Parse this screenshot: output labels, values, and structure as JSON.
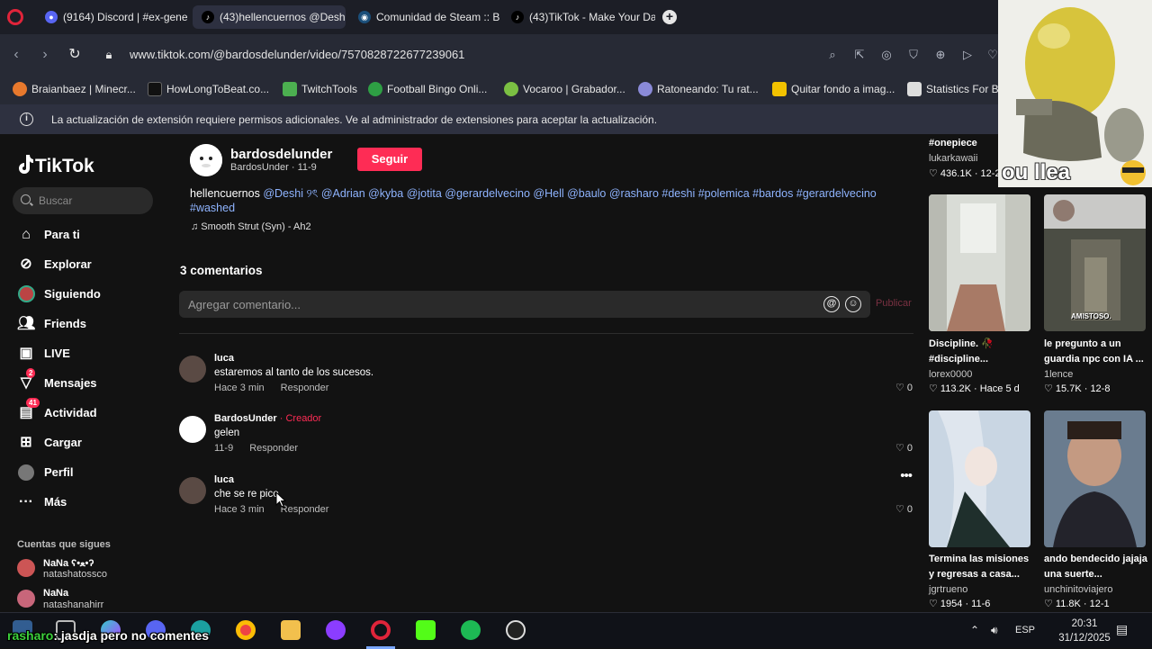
{
  "browser": {
    "tabs": [
      {
        "label": "(9164) Discord | #ex-gene",
        "icon": "discord-icon",
        "active": false
      },
      {
        "label": "(43)hellencuernos @Desh",
        "icon": "tiktok-icon",
        "active": true
      },
      {
        "label": "Comunidad de Steam :: Br",
        "icon": "steam-icon",
        "active": false
      },
      {
        "label": "(43)TikTok - Make Your Da",
        "icon": "tiktok-icon",
        "active": false
      }
    ],
    "new_tab": "+",
    "url": "www.tiktok.com/@bardosdelunder/video/7570828722677239061",
    "bookmarks": [
      {
        "label": "Braianbaez | Minecr...",
        "color": "#e8792d"
      },
      {
        "label": "HowLongToBeat.co...",
        "color": "#111111"
      },
      {
        "label": "TwitchTools",
        "color": "#4caf50"
      },
      {
        "label": "Football Bingo Onli...",
        "color": "#2e9f44"
      },
      {
        "label": "Vocaroo | Grabador...",
        "color": "#7bc043"
      },
      {
        "label": "Ratoneando: Tu rat...",
        "color": "#8a8ad8"
      },
      {
        "label": "Quitar fondo a imag...",
        "color": "#f2c200"
      },
      {
        "label": "Statistics For Be",
        "color": "#dddddd"
      }
    ],
    "info_message": "La actualización de extensión requiere permisos adicionales. Ve al administrador de extensiones para aceptar la actualización."
  },
  "webcam": {
    "caption": "ou llea"
  },
  "sidebar": {
    "logo": "TikTok",
    "search_placeholder": "Buscar",
    "nav": [
      {
        "label": "Para ti",
        "icon": "home-icon"
      },
      {
        "label": "Explorar",
        "icon": "compass-icon"
      },
      {
        "label": "Siguiendo",
        "icon": "following-avatar-icon"
      },
      {
        "label": "Friends",
        "icon": "friends-icon"
      },
      {
        "label": "LIVE",
        "icon": "live-icon"
      },
      {
        "label": "Mensajes",
        "icon": "messages-icon",
        "badge": "2"
      },
      {
        "label": "Actividad",
        "icon": "activity-icon",
        "badge": "41"
      },
      {
        "label": "Cargar",
        "icon": "upload-icon"
      },
      {
        "label": "Perfil",
        "icon": "profile-avatar-icon"
      },
      {
        "label": "Más",
        "icon": "more-icon"
      }
    ],
    "following_header": "Cuentas que sigues",
    "following": [
      {
        "name": "NaNa ʕ•ﻌ•ʔ",
        "handle": "natashatossco"
      },
      {
        "name": "NaNa",
        "handle": "natashanahirr"
      }
    ]
  },
  "video": {
    "author_name": "bardosdelunder",
    "author_sub": "BardosUnder · 11-9",
    "follow_label": "Seguir",
    "description_text": "hellencuernos",
    "description_tags": "@Deshi ୨ৎ @Adrian @kyba @jotita @gerardelvecino @Hell @baulo @rasharo #deshi #polemica #bardos #gerardelvecino #washed",
    "music": "♫ Smooth Strut (Syn) - Ah2"
  },
  "comments_section": {
    "title": "3 comentarios",
    "placeholder": "Agregar comentario...",
    "publish": "Publicar",
    "reply_label": "Responder",
    "comments": [
      {
        "user": "luca",
        "creator": "",
        "text": "estaremos al tanto de los sucesos.",
        "time": "Hace 3 min",
        "likes": "0"
      },
      {
        "user": "BardosUnder",
        "creator": " · Creador",
        "text": "gelen",
        "time": "11-9",
        "likes": "0"
      },
      {
        "user": "luca",
        "creator": "",
        "text": "che se re pico",
        "time": "Hace 3 min",
        "likes": "0"
      }
    ]
  },
  "related": {
    "top": [
      {
        "title": "#onepiece",
        "user": "lukarkawaii",
        "stats": "♡ 436.1K · 12-2"
      }
    ],
    "videos": [
      {
        "title": "Discipline. 🥀 #discipline...",
        "user": "lorex0000",
        "stats": "♡ 113.2K · Hace 5 d"
      },
      {
        "title": "le pregunto a un guardia npc con IA ...",
        "user": "1lence",
        "stats": "♡ 15.7K · 12-8",
        "thumb_text": "AMISTOSO."
      },
      {
        "title": "Termina las misiones y regresas a casa...",
        "user": "jgrtrueno",
        "stats": "♡ 1954 · 11-6"
      },
      {
        "title": "ando bendecido jajaja una suerte...",
        "user": "unchinitoviajero",
        "stats": "♡ 11.8K · 12-1"
      }
    ]
  },
  "taskbar": {
    "chat_user": "rasharo",
    "chat_text": ": jasdja pero no comentes",
    "lang": "ESP",
    "time": "20:31",
    "date": "31/12/2025"
  }
}
